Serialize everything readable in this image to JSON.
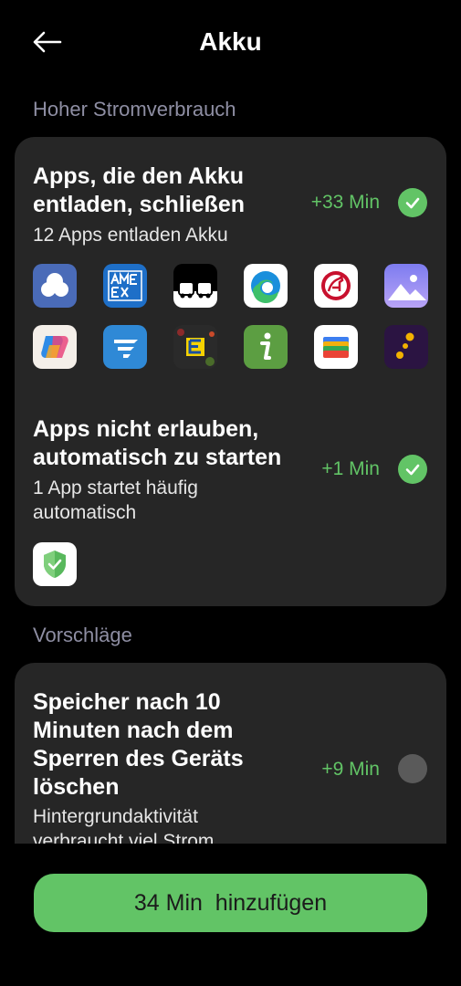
{
  "header": {
    "title": "Akku"
  },
  "sections": {
    "high_usage": "Hoher Stromverbrauch",
    "suggestions": "Vorschläge"
  },
  "close_apps": {
    "title_line1": "Apps, die den Akku",
    "title_line2": "entladen, schließen",
    "subtitle": "12 Apps entladen Akku",
    "gain": "+33 Min",
    "checked": true,
    "apps": [
      "cloud-app-icon",
      "amex-app-icon",
      "traffic-app-icon",
      "edge-browser-icon",
      "rossmann-app-icon",
      "gallery-app-icon",
      "copilot-app-icon",
      "flight-app-icon",
      "edeka-app-icon",
      "info-app-icon",
      "wallet-app-icon",
      "dots-app-icon"
    ]
  },
  "autostart": {
    "title_line1": "Apps nicht erlauben,",
    "title_line2": "automatisch zu starten",
    "subtitle_line1": "1 App startet häufig",
    "subtitle_line2": "automatisch",
    "gain": "+1 Min",
    "checked": true,
    "apps": [
      "shield-app-icon"
    ]
  },
  "memory": {
    "title_line1": "Speicher nach 10",
    "title_line2": "Minuten nach dem",
    "title_line3": "Sperren des Geräts",
    "title_line4": "löschen",
    "subtitle_line1": "Hintergrundaktivität",
    "subtitle_line2": "verbraucht viel Strom",
    "gain": "+9 Min",
    "checked": false
  },
  "cta": {
    "label": "34 Min  hinzufügen"
  },
  "colors": {
    "accent": "#62c466",
    "card": "#262626",
    "background": "#000000"
  }
}
